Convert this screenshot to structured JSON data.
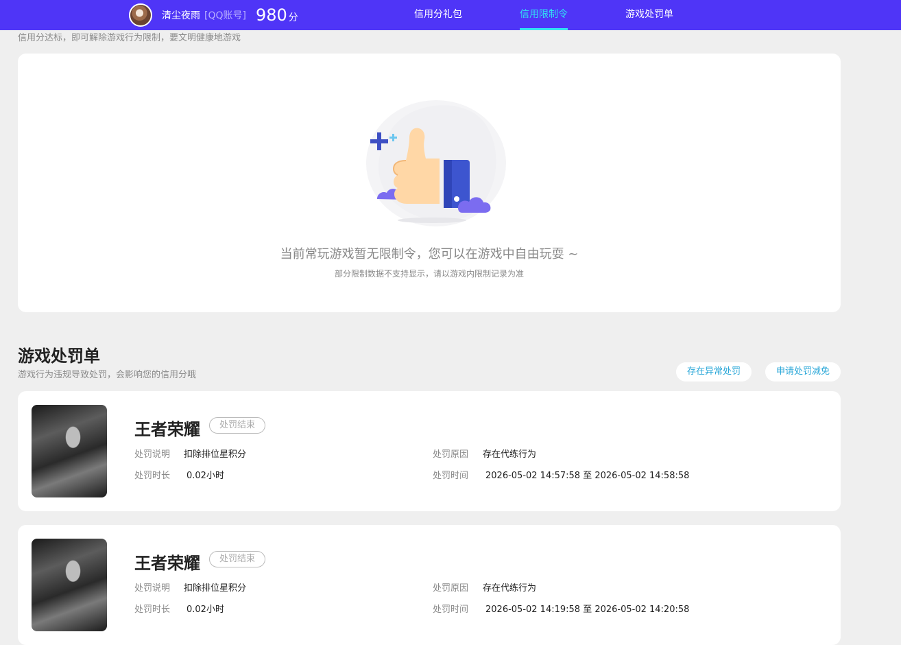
{
  "header": {
    "username": "清尘夜雨",
    "account_type": "[QQ账号]",
    "score": "980",
    "score_unit": "分",
    "nav": [
      {
        "label": "信用分礼包",
        "active": false
      },
      {
        "label": "信用限制令",
        "active": true
      },
      {
        "label": "游戏处罚单",
        "active": false
      }
    ]
  },
  "restrictions": {
    "subtitle": "信用分达标，即可解除游戏行为限制，要文明健康地游戏",
    "empty_title": "当前常玩游戏暂无限制令，您可以在游戏中自由玩耍 ~",
    "empty_subtitle": "部分限制数据不支持显示，请以游戏内限制记录为准"
  },
  "penalties": {
    "title": "游戏处罚单",
    "subtitle": "游戏行为违规导致处罚，会影响您的信用分哦",
    "btn_abnormal": "存在异常处罚",
    "btn_reduce": "申请处罚减免",
    "labels": {
      "desc": "处罚说明",
      "duration": "处罚时长",
      "reason": "处罚原因",
      "time": "处罚时间"
    },
    "items": [
      {
        "game": "王者荣耀",
        "status": "处罚结束",
        "desc": "扣除排位星积分",
        "duration": "0.02小时",
        "reason": "存在代练行为",
        "time": "2026-05-02 14:57:58 至 2026-05-02 14:58:58"
      },
      {
        "game": "王者荣耀",
        "status": "处罚结束",
        "desc": "扣除排位星积分",
        "duration": "0.02小时",
        "reason": "存在代练行为",
        "time": "2026-05-02 14:19:58 至 2026-05-02 14:20:58"
      }
    ]
  }
}
